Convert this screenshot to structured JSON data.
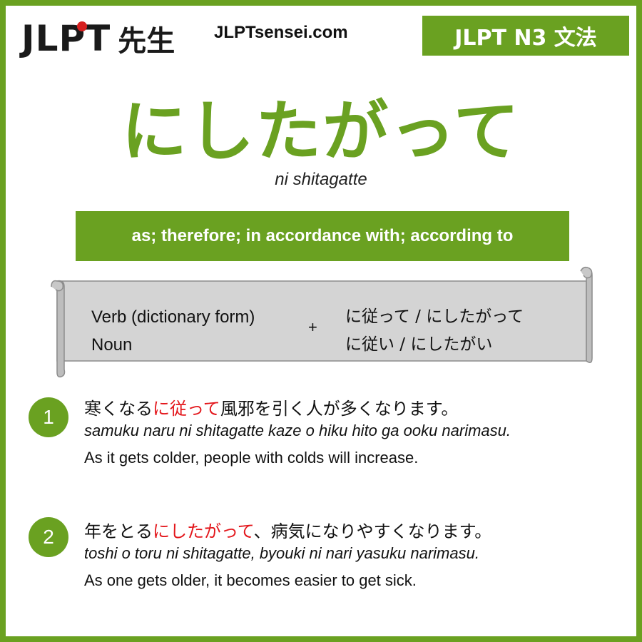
{
  "header": {
    "logo_jlpt": "JLPT",
    "logo_sensei": "先生",
    "site_url": "JLPTsensei.com",
    "level_badge": "JLPT N3 文法"
  },
  "grammar": {
    "title": "にしたがって",
    "romaji": "ni shitagatte",
    "meaning": "as; therefore; in accordance with; according to"
  },
  "formation": {
    "left": [
      "Verb (dictionary form)",
      "Noun"
    ],
    "plus": "+",
    "right": [
      "に従って / にしたがって",
      "に従い / にしたがい"
    ]
  },
  "examples": [
    {
      "number": "1",
      "jp_before": "寒くなる",
      "jp_highlight": "に従って",
      "jp_after": "風邪を引く人が多くなります。",
      "romaji": "samuku naru ni shitagatte kaze o hiku hito ga ooku narimasu.",
      "english": "As it gets colder, people with colds will increase."
    },
    {
      "number": "2",
      "jp_before": "年をとる",
      "jp_highlight": "にしたがって",
      "jp_after": "、病気になりやすくなります。",
      "romaji": "toshi o toru ni shitagatte, byouki ni nari yasuku narimasu.",
      "english": "As one gets older, it becomes easier to get sick."
    }
  ],
  "colors": {
    "accent": "#6aa121",
    "highlight": "#e3151a",
    "scroll_fill": "#d4d4d4"
  }
}
